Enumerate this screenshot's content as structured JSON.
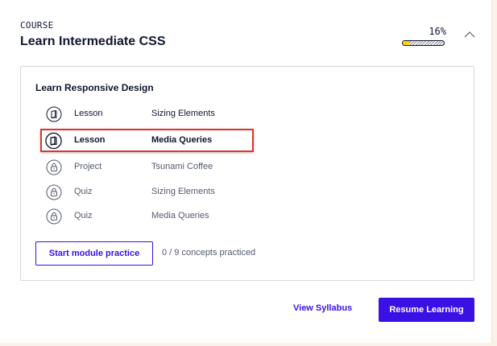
{
  "course": {
    "kicker": "COURSE",
    "title": "Learn Intermediate CSS",
    "progress_label": "16%",
    "progress_fraction": 0.16,
    "collapse_icon": "chevron-up-icon"
  },
  "module": {
    "title": "Learn Responsive Design",
    "items": [
      {
        "type": "Lesson",
        "name": "Sizing Elements",
        "icon": "lesson-book-icon",
        "state": "available"
      },
      {
        "type": "Lesson",
        "name": "Media Queries",
        "icon": "lesson-book-icon",
        "state": "current"
      },
      {
        "type": "Project",
        "name": "Tsunami Coffee",
        "icon": "lock-icon",
        "state": "locked"
      },
      {
        "type": "Quiz",
        "name": "Sizing Elements",
        "icon": "lock-icon",
        "state": "locked"
      },
      {
        "type": "Quiz",
        "name": "Media Queries",
        "icon": "lock-icon",
        "state": "locked"
      }
    ],
    "practice_button": "Start module practice",
    "practice_status": "0 / 9 concepts practiced"
  },
  "footer": {
    "syllabus_link": "View Syllabus",
    "resume_button": "Resume Learning"
  },
  "colors": {
    "accent": "#3a10e5",
    "progress_fill": "#ffd300",
    "highlight": "#e0342e",
    "background": "#fbf1e8",
    "text": "#10162f"
  }
}
